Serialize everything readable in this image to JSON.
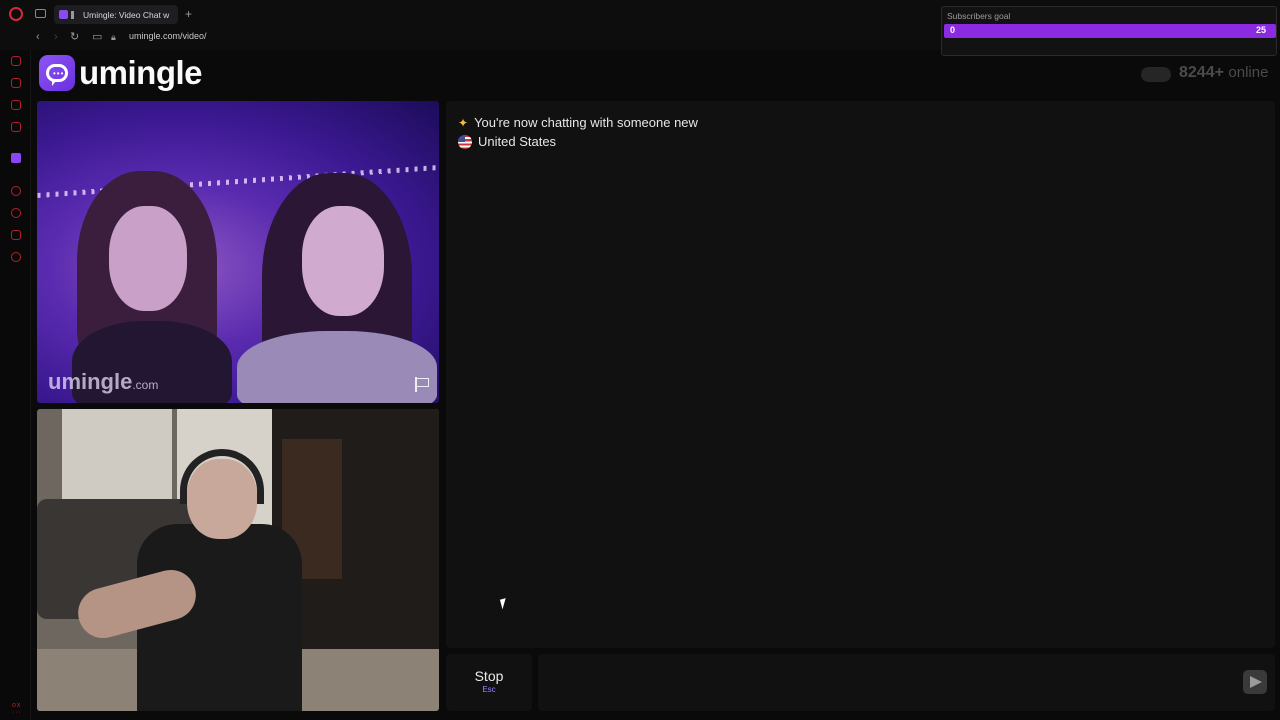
{
  "browser": {
    "tab_title": "Umingle: Video Chat w",
    "new_tab_label": "+",
    "url": "umingle.com/video/"
  },
  "site": {
    "logo_text": "umingle",
    "online_count": "8244+",
    "online_label": "online"
  },
  "goal_widget": {
    "title": "Subscribers goal",
    "current": "0",
    "target": "25",
    "progress_fraction": 0.0
  },
  "video": {
    "watermark_main": "umingle",
    "watermark_suffix": ".com"
  },
  "chat": {
    "messages": [
      {
        "icon": "sparkles-icon",
        "text": "You're now chatting with someone new"
      },
      {
        "icon": "us-flag-icon",
        "text": "United States"
      }
    ]
  },
  "controls": {
    "stop_label": "Stop",
    "stop_shortcut": "Esc",
    "message_placeholder": ""
  },
  "colors": {
    "accent": "#8a2be2",
    "brand": "#7b3ff0",
    "opera_red": "#d42a3a"
  }
}
